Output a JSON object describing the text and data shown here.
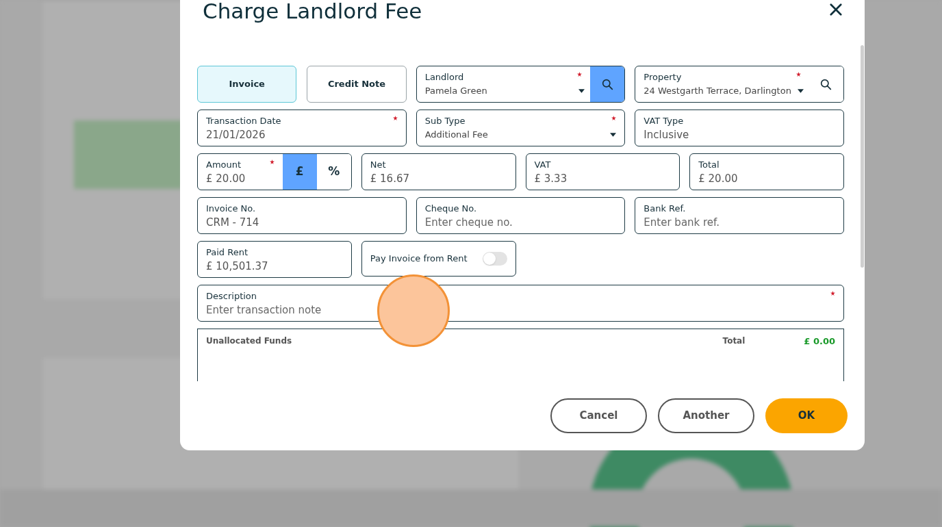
{
  "dialog": {
    "title": "Charge Landlord Fee"
  },
  "rows": [
    {
      "fields": [
        {
          "kind": "doc_type",
          "options": [
            {
              "label": "Invoice",
              "selected": true
            },
            {
              "label": "Credit Note",
              "selected": false
            }
          ]
        },
        {
          "kind": "lookup",
          "label": "Landlord",
          "value": "Pamela Green",
          "required": true,
          "search_active": true
        },
        {
          "kind": "lookup",
          "label": "Property",
          "value": "24 Westgarth Terrace, Darlington",
          "required": true,
          "search_active": false
        }
      ]
    },
    {
      "fields": [
        {
          "kind": "text",
          "label": "Transaction Date",
          "value": "21/01/2026",
          "required": true
        },
        {
          "kind": "select",
          "label": "Sub Type",
          "value": "Additional Fee",
          "required": true
        },
        {
          "kind": "text",
          "label": "VAT Type",
          "value": "Inclusive",
          "required": false
        }
      ]
    },
    {
      "fields": [
        {
          "kind": "amount",
          "label": "Amount",
          "value": "£ 20.00",
          "required": true,
          "units": [
            {
              "label": "£",
              "selected": true
            },
            {
              "label": "%",
              "selected": false
            }
          ]
        },
        {
          "kind": "text",
          "label": "Net",
          "value": "£ 16.67",
          "required": false
        },
        {
          "kind": "text",
          "label": "VAT",
          "value": "£ 3.33",
          "required": false
        },
        {
          "kind": "text",
          "label": "Total",
          "value": "£ 20.00",
          "required": false
        }
      ]
    },
    {
      "fields": [
        {
          "kind": "text",
          "label": "Invoice No.",
          "value": "CRM - 714",
          "required": false
        },
        {
          "kind": "text",
          "label": "Cheque No.",
          "placeholder": "Enter cheque no.",
          "required": false
        },
        {
          "kind": "text",
          "label": "Bank Ref.",
          "placeholder": "Enter bank ref.",
          "required": false
        }
      ]
    },
    {
      "fields": [
        {
          "kind": "text",
          "label": "Paid Rent",
          "value": "£ 10,501.37",
          "required": false
        },
        {
          "kind": "toggle",
          "label": "Pay Invoice from Rent",
          "on": false
        }
      ]
    },
    {
      "fields": [
        {
          "kind": "text",
          "label": "Description",
          "placeholder": "Enter transaction note",
          "required": true
        }
      ]
    }
  ],
  "unallocated": {
    "label": "Unallocated Funds",
    "total_label": "Total",
    "total": "£ 0.00"
  },
  "buttons": [
    {
      "label": "Cancel",
      "kind": "secondary"
    },
    {
      "label": "Another",
      "kind": "secondary"
    },
    {
      "label": "OK",
      "kind": "primary"
    }
  ]
}
